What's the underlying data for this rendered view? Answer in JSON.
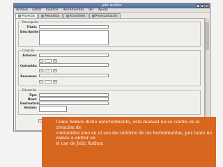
{
  "window": {
    "title": "Jelic Author"
  },
  "menu": {
    "items": [
      "Archivo",
      "Editar",
      "Insertar",
      "Herramientas",
      "Ver",
      "Ayuda"
    ]
  },
  "tabs": [
    {
      "label": "Proyectos"
    },
    {
      "label": "Metadatos"
    },
    {
      "label": "Actividades"
    },
    {
      "label": "Previsualización"
    }
  ],
  "sections": {
    "general": {
      "legend": "Descripción",
      "title_label": "Título:",
      "description_label": "Descripción:"
    },
    "creation": {
      "legend": "Creación",
      "author_label": "Autor/es:",
      "content_label": "Contenido:",
      "reviewers_label": "Revisores:"
    },
    "educational": {
      "legend": "Educación",
      "type_label": "Tipo:",
      "level_label": "Nivel:",
      "recipients_label": "Destinatarios:",
      "version_label": "Versión:"
    }
  },
  "stepper": {
    "minus": "-",
    "plus": "+",
    "value": "—"
  },
  "caption": {
    "lines": [
      "Como hemos dicho anteriormente, este manual no se centra en la",
      "creación de",
      "contenidos sino en el uso del entorno de las herramientas, por tanto no",
      "vamos a entrar en",
      "el uso de Jelic Author."
    ]
  }
}
